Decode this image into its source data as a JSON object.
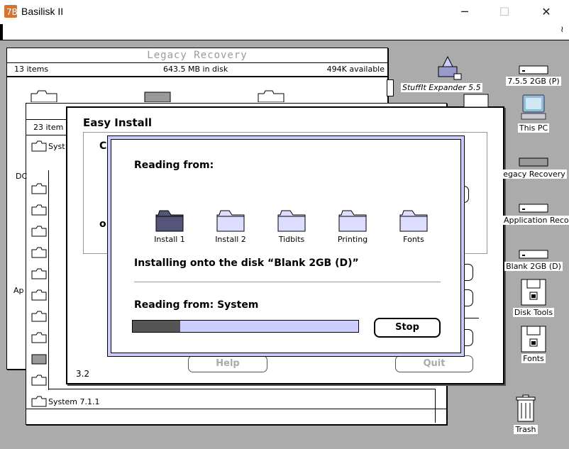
{
  "host": {
    "title": "Basilisk II",
    "minimize": "─",
    "maximize": "☐",
    "close": "✕"
  },
  "legacy_window": {
    "title": "Legacy Recovery",
    "items": "13 items",
    "disk": "643.5 MB in disk",
    "available": "494K available"
  },
  "second_window": {
    "items": "23 item",
    "rows": [
      "Syst",
      "",
      "",
      "",
      "",
      "",
      "",
      "",
      "",
      "",
      "",
      "System 7.1.1"
    ]
  },
  "left_labels": {
    "dc": "DC",
    "app": "Ap"
  },
  "easy_install": {
    "title": "Easy Install",
    "c_label": "C",
    "o_label": "o",
    "help": "Help",
    "quit": "Quit",
    "version": "3.2"
  },
  "progress_dialog": {
    "reading_from": "Reading from:",
    "folders": [
      "Install 1",
      "Install 2",
      "Tidbits",
      "Printing",
      "Fonts"
    ],
    "installing": "Installing onto the disk “Blank 2GB (D)”",
    "reading_system": "Reading from: System",
    "progress": 0.21,
    "stop": "Stop"
  },
  "desktop_icons": [
    "StuffIt Expander 5.5",
    "7.5.5 2GB (P)",
    "This PC",
    "egacy Recovery",
    "Application Reco",
    "Blank 2GB (D)",
    "Disk Tools",
    "Fonts",
    "Trash"
  ],
  "colors": {
    "dialog_fill": "#ccccff",
    "progress_fill": "#555555",
    "desktop": "#ababab"
  }
}
